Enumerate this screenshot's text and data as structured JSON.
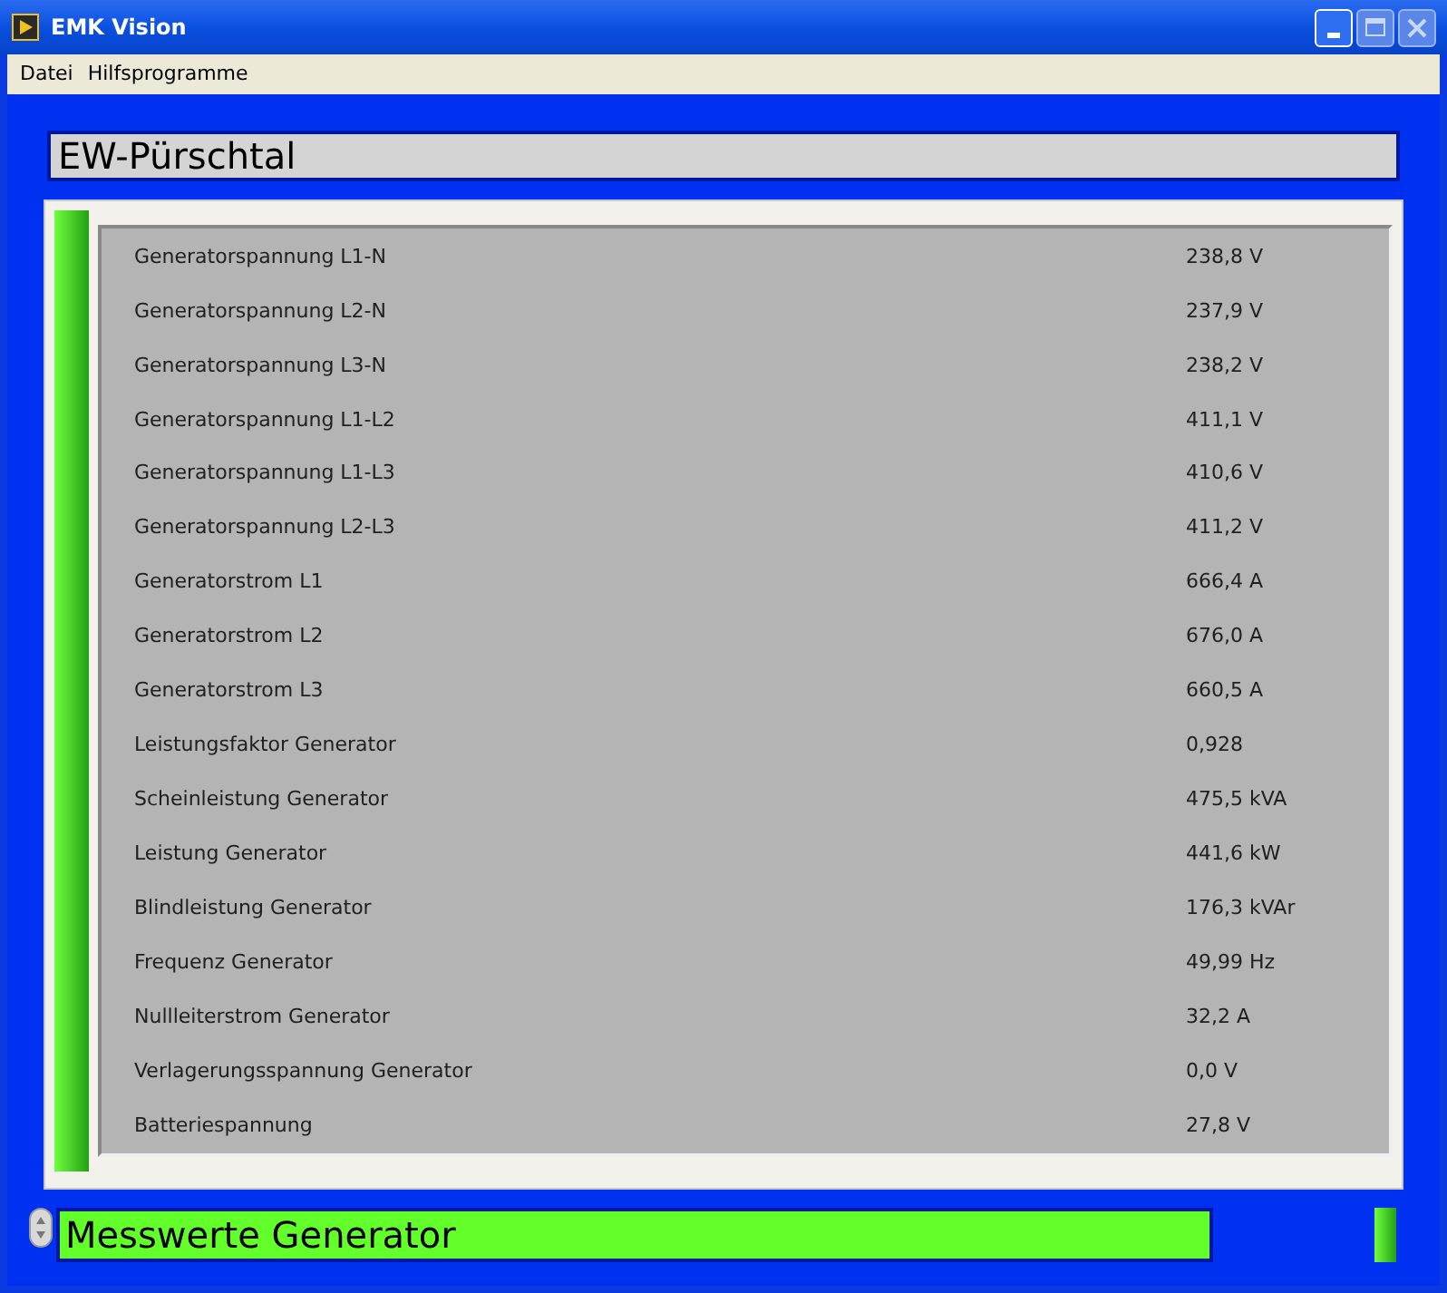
{
  "window": {
    "title": "EMK Vision"
  },
  "menu": [
    "Datei",
    "Hilfsprogramme"
  ],
  "station": "EW-Pürschtal",
  "rows": [
    {
      "label": "Generatorspannung L1-N",
      "value": "238,8 V"
    },
    {
      "label": "Generatorspannung L2-N",
      "value": "237,9 V"
    },
    {
      "label": "Generatorspannung L3-N",
      "value": "238,2 V"
    },
    {
      "label": "Generatorspannung L1-L2",
      "value": "411,1 V"
    },
    {
      "label": "Generatorspannung L1-L3",
      "value": "410,6 V"
    },
    {
      "label": "Generatorspannung L2-L3",
      "value": "411,2 V"
    },
    {
      "label": "Generatorstrom L1",
      "value": "666,4 A"
    },
    {
      "label": "Generatorstrom L2",
      "value": "676,0 A"
    },
    {
      "label": "Generatorstrom L3",
      "value": "660,5 A"
    },
    {
      "label": "Leistungsfaktor Generator",
      "value": "0,928"
    },
    {
      "label": "Scheinleistung Generator",
      "value": "475,5 kVA"
    },
    {
      "label": "Leistung Generator",
      "value": "441,6 kW"
    },
    {
      "label": "Blindleistung Generator",
      "value": "176,3 kVAr"
    },
    {
      "label": "Frequenz Generator",
      "value": "49,99 Hz"
    },
    {
      "label": "Nullleiterstrom Generator",
      "value": "32,2 A"
    },
    {
      "label": "Verlagerungsspannung Generator",
      "value": "0,0 V"
    },
    {
      "label": "Batteriespannung",
      "value": "27,8 V"
    }
  ],
  "page_selector": {
    "value": "Messwerte Generator"
  }
}
